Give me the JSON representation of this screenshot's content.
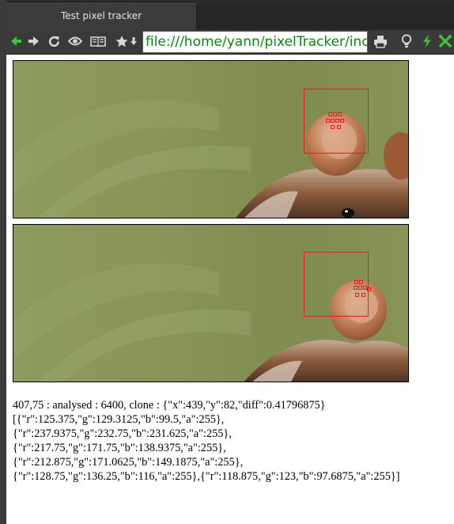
{
  "browser": {
    "tab_title": "Test pixel tracker",
    "url": "file:///home/yann/pixelTracker/inc",
    "toolbar_icons": [
      "back-arrow-icon",
      "forward-arrow-icon",
      "reload-icon",
      "eye-icon",
      "reader-icon",
      "star-icon",
      "star-dropdown-icon",
      "print-icon",
      "bulb-icon",
      "bolt-icon",
      "tools-icon"
    ]
  },
  "output": {
    "status_line": "407,75 : analysed : 6400, clone : {\"x\":439,\"y\":82,\"diff\":0.41796875}",
    "pixels_lines": [
      "[{\"r\":125.375,\"g\":129.3125,\"b\":99.5,\"a\":255},",
      "{\"r\":237.9375,\"g\":232.75,\"b\":231.625,\"a\":255},",
      "{\"r\":217.75,\"g\":171.75,\"b\":138.9375,\"a\":255},",
      "{\"r\":212.875,\"g\":171.0625,\"b\":149.1875,\"a\":255},",
      "{\"r\":128.75,\"g\":136.25,\"b\":116,\"a\":255},{\"r\":118.875,\"g\":123,\"b\":97.6875,\"a\":255}]"
    ]
  },
  "colors": {
    "tracker_red": "#e02020",
    "url_green": "#0a8a0a",
    "nav_green": "#3cc43c"
  }
}
